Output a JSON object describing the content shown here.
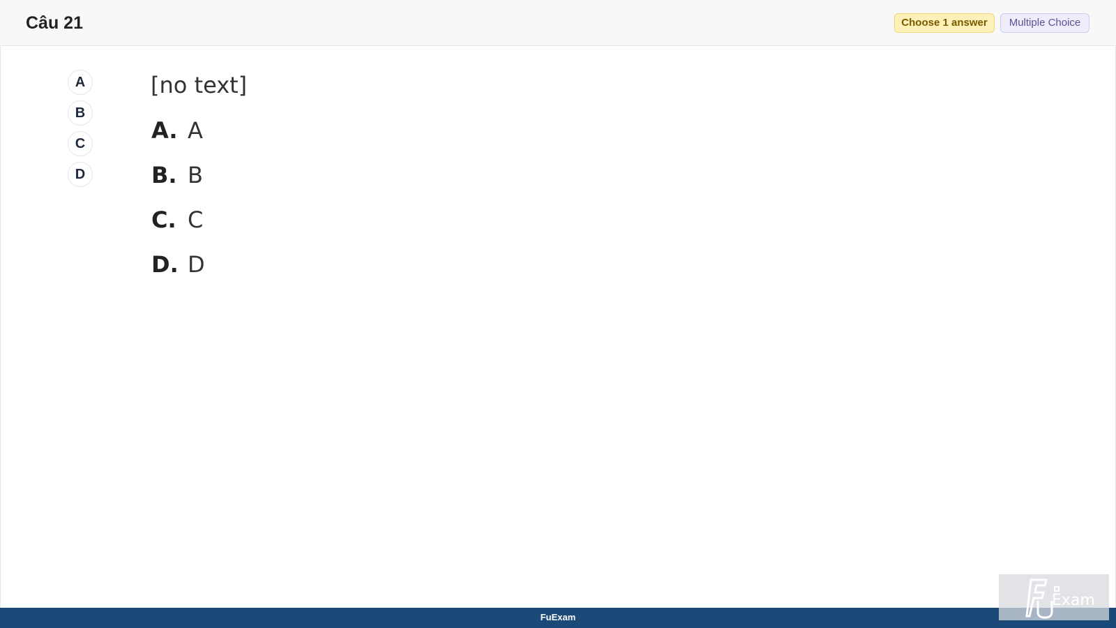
{
  "question": {
    "title": "Câu 21",
    "stem": "[no text]"
  },
  "badges": {
    "choose": "Choose 1 answer",
    "type": "Multiple Choice"
  },
  "answer_bubbles": [
    "A",
    "B",
    "C",
    "D"
  ],
  "options": [
    {
      "letter": "A.",
      "text": "A"
    },
    {
      "letter": "B.",
      "text": "B"
    },
    {
      "letter": "C.",
      "text": "C"
    },
    {
      "letter": "D.",
      "text": "D"
    }
  ],
  "footer": {
    "brand": "FuExam"
  },
  "watermark": {
    "logo_text": "FU Exam"
  }
}
